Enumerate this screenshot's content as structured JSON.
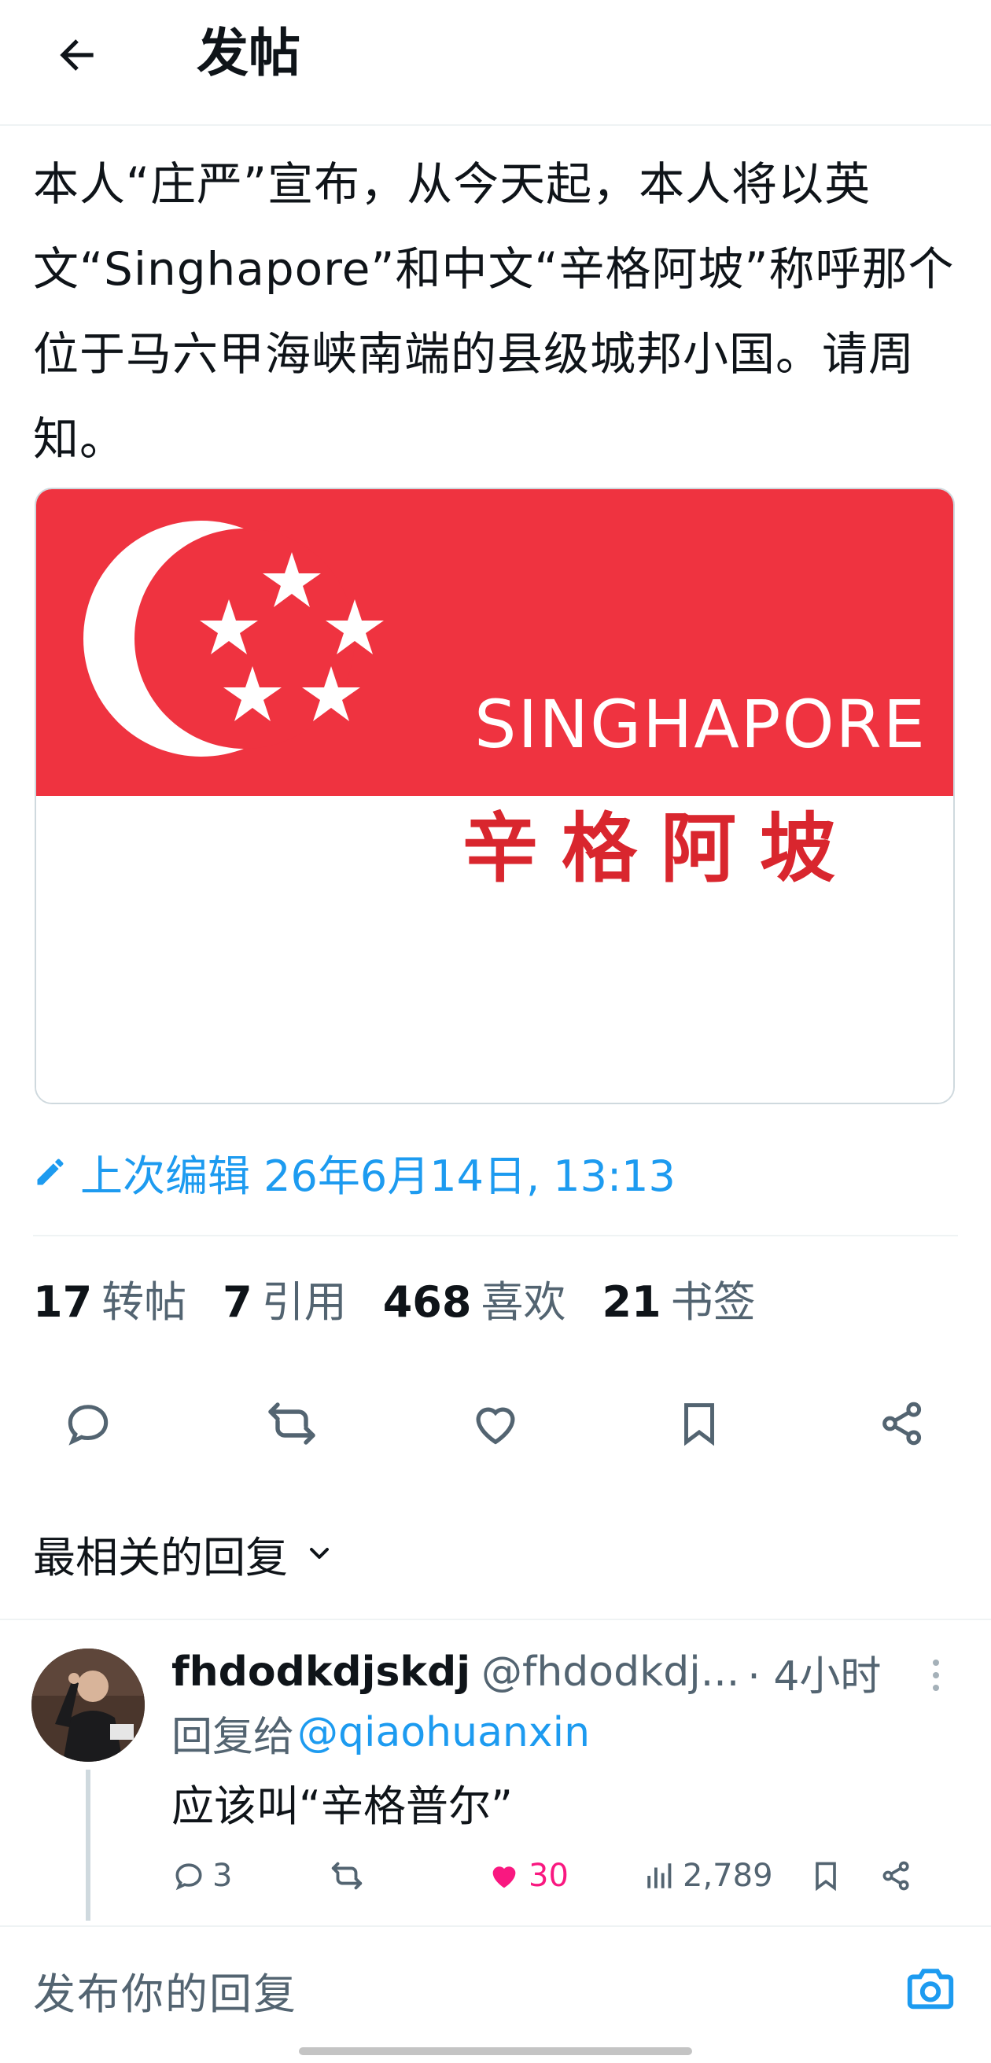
{
  "header": {
    "title": "发帖",
    "back_icon": "arrow-left-icon"
  },
  "post": {
    "text": "本人“庄严”宣布，从今天起，本人将以英文“Singhapore”和中文“辛格阿坡”称呼那个位于马六甲海峡南端的县级城邦小国。请周知。",
    "image": {
      "english_text": "SINGHAPORE",
      "chinese_text": "辛格阿坡",
      "colors": {
        "red": "#ef3340",
        "white": "#ffffff",
        "chinese_text": "#d9262e"
      }
    },
    "edited": "上次编辑 26年6月14日, 13:13"
  },
  "stats": {
    "reposts": {
      "count": "17",
      "label": "转帖"
    },
    "quotes": {
      "count": "7",
      "label": "引用"
    },
    "likes": {
      "count": "468",
      "label": "喜欢"
    },
    "bookmarks": {
      "count": "21",
      "label": "书签"
    }
  },
  "actions": [
    "reply-icon",
    "repost-icon",
    "like-icon",
    "bookmark-icon",
    "share-icon"
  ],
  "replies_sort": {
    "label": "最相关的回复"
  },
  "reply": {
    "name": "fhdodkdjskdj",
    "handle": "@fhdodkdj...",
    "time": "· 4小时",
    "reply_to_label": "回复给",
    "reply_to_handle": "@qiaohuanxin",
    "text": "应该叫“辛格普尔”",
    "replies": "3",
    "reposts": "",
    "likes": "30",
    "views": "2,789"
  },
  "composer": {
    "placeholder": "发布你的回复"
  },
  "colors": {
    "accent": "#1d9bf0",
    "like": "#f91880",
    "text": "#0f1419",
    "muted": "#536471"
  }
}
